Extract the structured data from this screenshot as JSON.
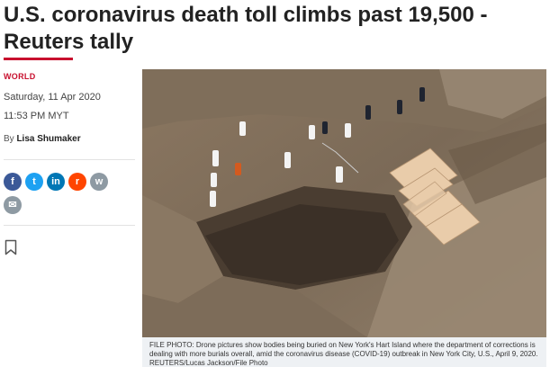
{
  "article": {
    "headline": "U.S. coronavirus death toll climbs past 19,500 - Reuters tally",
    "section": "WORLD",
    "date": "Saturday, 11 Apr 2020",
    "time": "11:53 PM MYT",
    "byline_prefix": "By",
    "author": "Lisa Shumaker",
    "accent_color": "#c8102e"
  },
  "share": [
    {
      "name": "facebook-icon",
      "glyph": "f",
      "color": "#3b5998"
    },
    {
      "name": "twitter-icon",
      "glyph": "t",
      "color": "#1da1f2"
    },
    {
      "name": "linkedin-icon",
      "glyph": "in",
      "color": "#0077b5"
    },
    {
      "name": "reddit-icon",
      "glyph": "r",
      "color": "#ff4500"
    },
    {
      "name": "whatsapp-icon",
      "glyph": "w",
      "color": "#8e9aa3"
    },
    {
      "name": "email-icon",
      "glyph": "✉",
      "color": "#8e9aa3"
    }
  ],
  "photo": {
    "caption": "FILE PHOTO: Drone pictures show bodies being buried on New York's Hart Island where the department of corrections is dealing with more burials overall, amid the coronavirus disease (COVID-19) outbreak in New York City, U.S., April 9, 2020. REUTERS/Lucas Jackson/File Photo"
  }
}
